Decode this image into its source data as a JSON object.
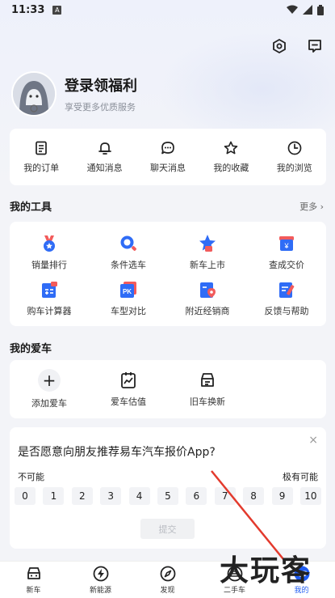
{
  "status": {
    "time": "11:33",
    "badge": "A"
  },
  "profile": {
    "title": "登录领福利",
    "subtitle": "享受更多优质服务"
  },
  "quick_actions": [
    {
      "label": "我的订单",
      "icon": "order-icon"
    },
    {
      "label": "通知消息",
      "icon": "bell-icon"
    },
    {
      "label": "聊天消息",
      "icon": "chat-icon"
    },
    {
      "label": "我的收藏",
      "icon": "star-icon"
    },
    {
      "label": "我的浏览",
      "icon": "clock-icon"
    }
  ],
  "tools": {
    "title": "我的工具",
    "more": "更多",
    "items": [
      {
        "label": "销量排行",
        "icon": "rank-medal-icon"
      },
      {
        "label": "条件选车",
        "icon": "search-car-icon"
      },
      {
        "label": "新车上市",
        "icon": "new-car-star-icon"
      },
      {
        "label": "查成交价",
        "icon": "price-icon"
      },
      {
        "label": "购车计算器",
        "icon": "calculator-icon"
      },
      {
        "label": "车型对比",
        "icon": "pk-compare-icon"
      },
      {
        "label": "附近经销商",
        "icon": "dealer-location-icon"
      },
      {
        "label": "反馈与帮助",
        "icon": "feedback-icon"
      }
    ]
  },
  "my_car": {
    "title": "我的爱车",
    "items": [
      {
        "label": "添加爱车",
        "icon": "plus-icon"
      },
      {
        "label": "爱车估值",
        "icon": "valuation-chart-icon"
      },
      {
        "label": "旧车换新",
        "icon": "car-exchange-icon"
      }
    ]
  },
  "survey": {
    "question": "是否愿意向朋友推荐易车汽车报价App?",
    "low_label": "不可能",
    "high_label": "极有可能",
    "scale": [
      "0",
      "1",
      "2",
      "3",
      "4",
      "5",
      "6",
      "7",
      "8",
      "9",
      "10"
    ],
    "submit": "提交",
    "close": "×"
  },
  "tabbar": [
    {
      "label": "新车",
      "icon": "car-front-icon",
      "active": false
    },
    {
      "label": "新能源",
      "icon": "lightning-icon",
      "active": false
    },
    {
      "label": "发现",
      "icon": "compass-icon",
      "active": false
    },
    {
      "label": "二手车",
      "icon": "used-car-icon",
      "active": false
    },
    {
      "label": "我的",
      "icon": "profile-icon",
      "active": true
    }
  ],
  "watermark": "大玩客",
  "colors": {
    "accent": "#1f5cf2",
    "background": "#f3f4f8",
    "card": "#ffffff"
  }
}
